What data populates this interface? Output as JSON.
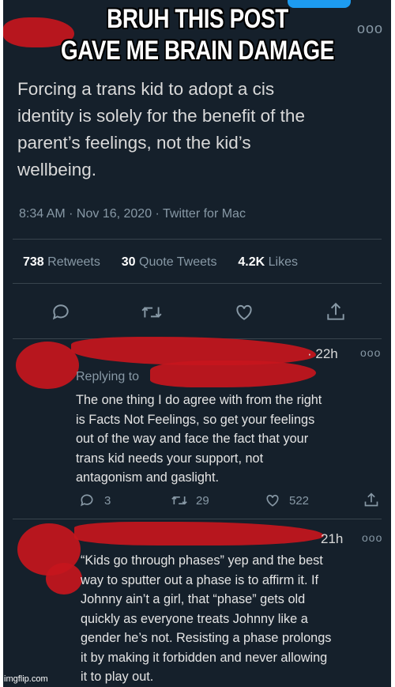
{
  "caption": {
    "line1": "BRUH THIS POST",
    "line2": "GAVE ME BRAIN DAMAGE"
  },
  "main_tweet": {
    "text_lines": [
      "Forcing a trans kid to adopt a cis",
      "identity is solely for the benefit of the",
      "parent’s feelings, not the kid’s",
      "wellbeing."
    ],
    "timestamp": "8:34 AM · Nov 16, 2020 · Twitter for Mac",
    "retweets_count": "738",
    "retweets_label": "Retweets",
    "quote_count": "30",
    "quote_label": "Quote Tweets",
    "likes_count": "4.2K",
    "likes_label": "Likes"
  },
  "reply1": {
    "time": "· 22h",
    "replying_to": "Replying to",
    "text_lines": [
      "The one thing I do agree with from the right",
      "is Facts Not Feelings, so get your feelings",
      "out of the way and face the fact that your",
      "trans kid needs your support, not",
      "antagonism and gaslight."
    ],
    "reply_count": "3",
    "retweet_count": "29",
    "like_count": "522"
  },
  "reply2": {
    "time": "21h",
    "text_lines": [
      "“Kids go through phases” yep and the best",
      "way to sputter out a phase is to affirm it. If",
      "Johnny ain’t a girl, that “phase” gets old",
      "quickly as everyone treats Johnny like a",
      "gender he’s not. Resisting a phase prolongs",
      "it by making it forbidden and never allowing",
      "it to play out."
    ]
  },
  "more_icon_text": "ooo",
  "watermark": "imgflip.com",
  "colors": {
    "background": "#15202b",
    "text": "#d9d9d9",
    "muted": "#8899a6",
    "redaction": "#c5161d"
  },
  "icons": [
    "reply-icon",
    "retweet-icon",
    "like-icon",
    "share-icon",
    "more-icon"
  ]
}
